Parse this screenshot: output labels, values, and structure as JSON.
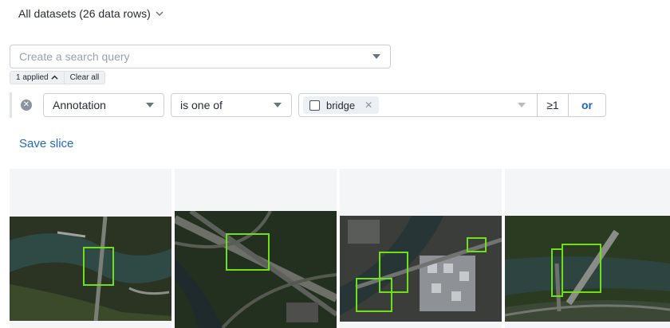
{
  "header": {
    "dataset_title": "All datasets (26 data rows)"
  },
  "search": {
    "placeholder": "Create a search query",
    "value": ""
  },
  "chips": {
    "applied": "1 applied",
    "clear": "Clear all"
  },
  "filter": {
    "attribute": "Annotation",
    "operator": "is one of",
    "value_chip": "bridge",
    "count": "≥1",
    "or_label": "or"
  },
  "actions": {
    "save_slice": "Save slice"
  },
  "colors": {
    "accent": "#2266c4",
    "bbox": "#6ee01a",
    "cell_bg": "#f4f5f7"
  },
  "icons": [
    "chevron-down-icon",
    "caret-down-icon",
    "chevron-up-icon",
    "remove-filter-icon",
    "checkbox-icon",
    "close-icon"
  ]
}
